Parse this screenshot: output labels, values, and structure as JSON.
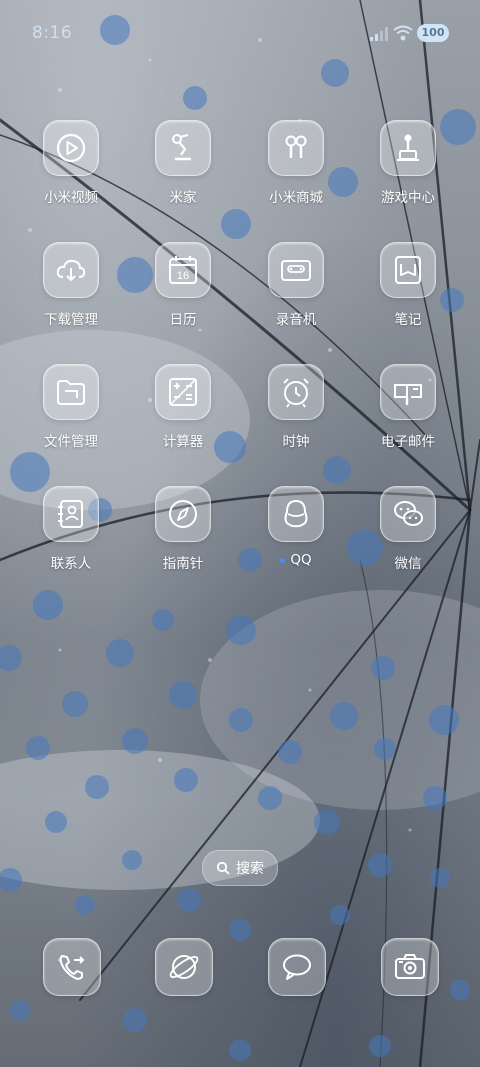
{
  "status_bar": {
    "time": "8:16",
    "battery": "100"
  },
  "apps": [
    {
      "label": "小米视频",
      "icon": "play-circle-icon"
    },
    {
      "label": "米家",
      "icon": "desk-lamp-icon"
    },
    {
      "label": "小米商城",
      "icon": "earbuds-icon"
    },
    {
      "label": "游戏中心",
      "icon": "joystick-icon"
    },
    {
      "label": "下载管理",
      "icon": "cloud-download-icon"
    },
    {
      "label": "日历",
      "icon": "calendar-icon",
      "day": "16"
    },
    {
      "label": "录音机",
      "icon": "cassette-icon"
    },
    {
      "label": "笔记",
      "icon": "notes-icon"
    },
    {
      "label": "文件管理",
      "icon": "folder-icon"
    },
    {
      "label": "计算器",
      "icon": "calculator-icon"
    },
    {
      "label": "时钟",
      "icon": "alarm-clock-icon"
    },
    {
      "label": "电子邮件",
      "icon": "mailbox-icon"
    },
    {
      "label": "联系人",
      "icon": "contacts-book-icon"
    },
    {
      "label": "指南针",
      "icon": "compass-icon"
    },
    {
      "label": "QQ",
      "icon": "qq-penguin-icon"
    },
    {
      "label": "微信",
      "icon": "wechat-bubbles-icon"
    }
  ],
  "search": {
    "label": "搜索"
  },
  "dock": [
    {
      "name": "phone",
      "icon": "phone-icon"
    },
    {
      "name": "browser",
      "icon": "planet-icon"
    },
    {
      "name": "messages",
      "icon": "chat-bubble-icon"
    },
    {
      "name": "camera",
      "icon": "camera-icon"
    }
  ]
}
